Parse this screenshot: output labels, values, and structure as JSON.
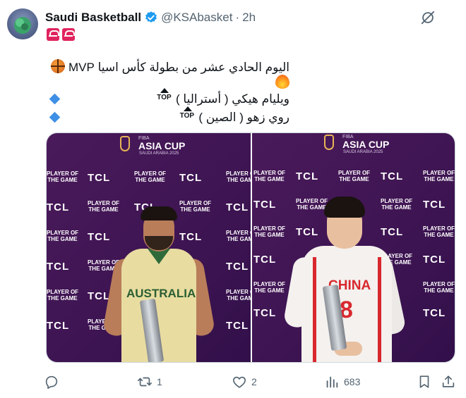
{
  "tweet": {
    "display_name": "Saudi Basketball",
    "handle": "@KSAbasket",
    "separator": "·",
    "time": "2h",
    "text_line1": "اليوم الحادي عشر من بطولة كأس اسيا MVP",
    "top_label": "TOP",
    "player1_line": "ويليام هيكي ( أستراليا )",
    "player2_line": "روي زهو ( الصين )"
  },
  "media": {
    "left": {
      "cup_title_line1": "ASIA CUP",
      "cup_sub": "SAUDI ARABIA 2025",
      "cup_fiba": "FIBA",
      "tcl": "TCL",
      "potg_line1": "PLAYER OF",
      "potg_line2": "THE GAME",
      "jersey_text": "AUSTRALIA"
    },
    "right": {
      "cup_title_line1": "ASIA CUP",
      "cup_sub": "SAUDI ARABIA 2025",
      "cup_fiba": "FIBA",
      "tcl": "TCL",
      "potg_line1": "PLAYER OF",
      "potg_line2": "THE GAME",
      "jersey_text": "CHINA",
      "jersey_number": "8"
    }
  },
  "actions": {
    "reply_icon": "reply-icon",
    "retweet_count": "1",
    "like_count": "2",
    "views_count": "683",
    "bookmark_icon": "bookmark-icon",
    "share_icon": "share-icon"
  },
  "colors": {
    "text": "#0f1419",
    "secondary": "#536471",
    "verified": "#1d9bf0",
    "backdrop": "#3d1452",
    "diamond": "#3e8fe6"
  }
}
